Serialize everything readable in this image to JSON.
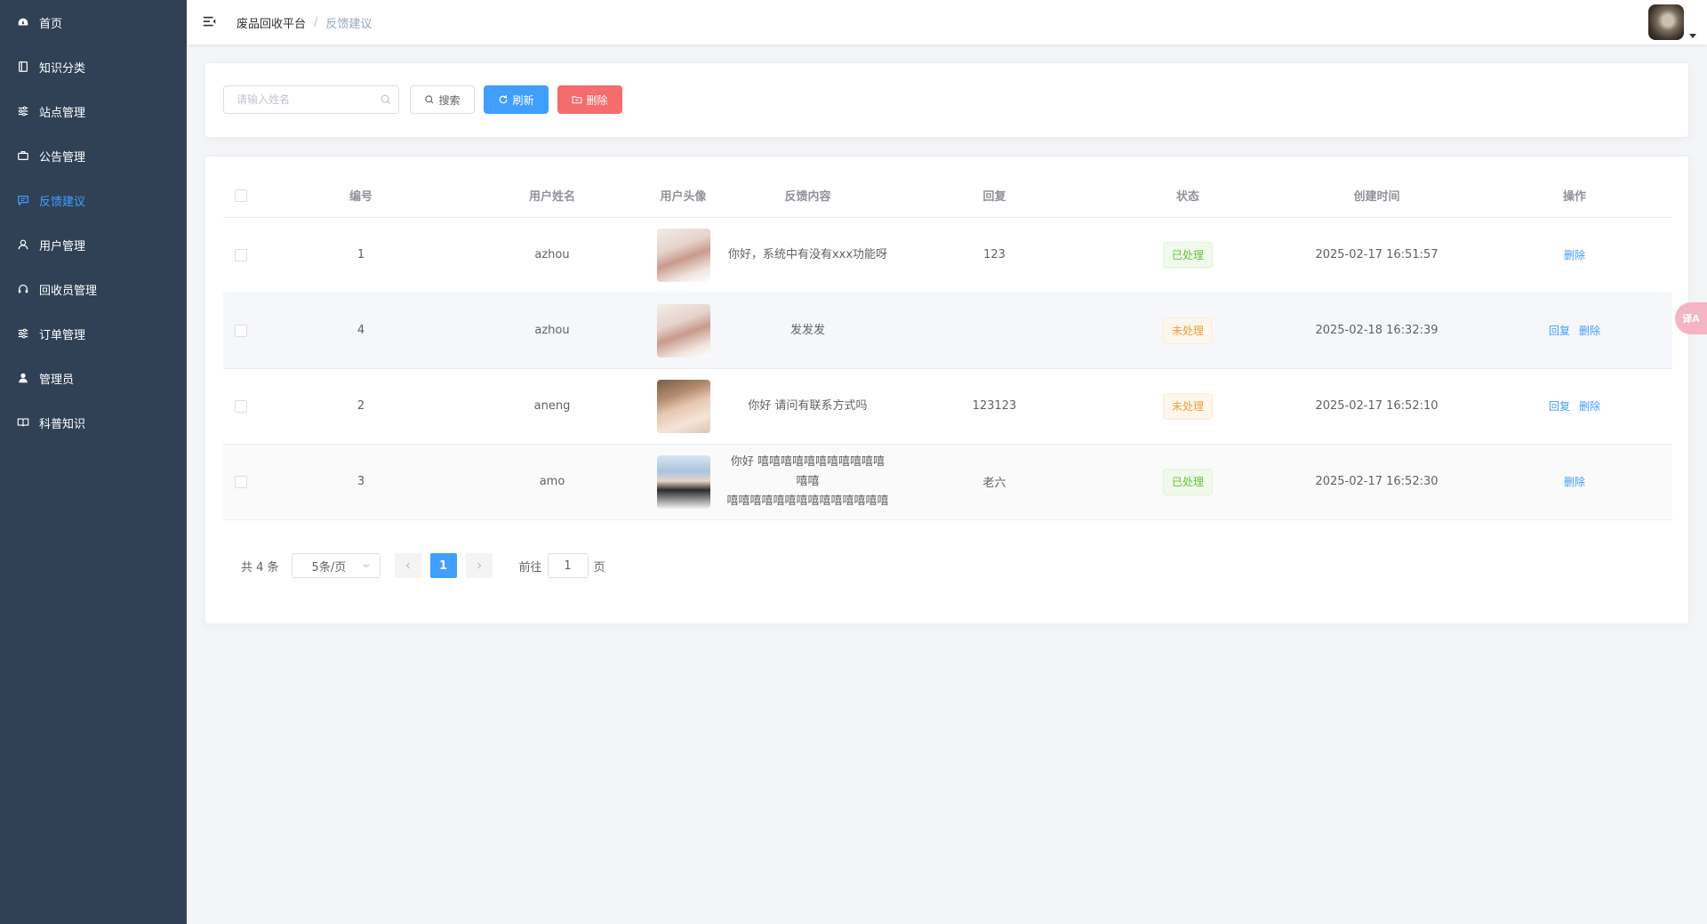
{
  "sidebar": {
    "items": [
      {
        "label": "首页",
        "icon": "dashboard-icon"
      },
      {
        "label": "知识分类",
        "icon": "book-icon"
      },
      {
        "label": "站点管理",
        "icon": "sliders-icon"
      },
      {
        "label": "公告管理",
        "icon": "briefcase-icon"
      },
      {
        "label": "反馈建议",
        "icon": "message-icon",
        "active": true
      },
      {
        "label": "用户管理",
        "icon": "user-icon"
      },
      {
        "label": "回收员管理",
        "icon": "headset-icon"
      },
      {
        "label": "订单管理",
        "icon": "sliders-icon"
      },
      {
        "label": "管理员",
        "icon": "admin-user-icon"
      },
      {
        "label": "科普知识",
        "icon": "open-book-icon"
      }
    ]
  },
  "header": {
    "breadcrumb_root": "废品回收平台",
    "breadcrumb_sep": "/",
    "breadcrumb_current": "反馈建议"
  },
  "search": {
    "placeholder": "请输入姓名",
    "search_label": "搜索",
    "refresh_label": "刷新",
    "delete_label": "删除"
  },
  "table": {
    "columns": [
      "编号",
      "用户姓名",
      "用户头像",
      "反馈内容",
      "回复",
      "状态",
      "创建时间",
      "操作"
    ],
    "rows": [
      {
        "id": "1",
        "name": "azhou",
        "content_line1": "你好，系统中有没有xxx功能呀",
        "content_line2": "",
        "reply": "123",
        "status": "已处理",
        "status_type": "success",
        "created": "2025-02-17 16:51:57",
        "reply_label": "",
        "delete_label": "删除"
      },
      {
        "id": "4",
        "name": "azhou",
        "content_line1": "发发发",
        "content_line2": "",
        "reply": "",
        "status": "未处理",
        "status_type": "warning",
        "created": "2025-02-18 16:32:39",
        "reply_label": "回复",
        "delete_label": "删除"
      },
      {
        "id": "2",
        "name": "aneng",
        "content_line1": "你好 请问有联系方式吗",
        "content_line2": "",
        "reply": "123123",
        "status": "未处理",
        "status_type": "warning",
        "created": "2025-02-17 16:52:10",
        "reply_label": "回复",
        "delete_label": "删除"
      },
      {
        "id": "3",
        "name": "amo",
        "content_line1": "你好 嘻嘻嘻嘻嘻嘻嘻嘻嘻嘻嘻嘻嘻",
        "content_line2": "嘻嘻嘻嘻嘻嘻嘻嘻嘻嘻嘻嘻嘻嘻",
        "reply": "老六",
        "status": "已处理",
        "status_type": "success",
        "created": "2025-02-17 16:52:30",
        "reply_label": "",
        "delete_label": "删除"
      }
    ]
  },
  "pagination": {
    "total": "共 4 条",
    "page_size": "5条/页",
    "current_page": "1",
    "goto_label": "前往",
    "goto_value": "1",
    "page_suffix": "页"
  },
  "translate_label": "译A"
}
